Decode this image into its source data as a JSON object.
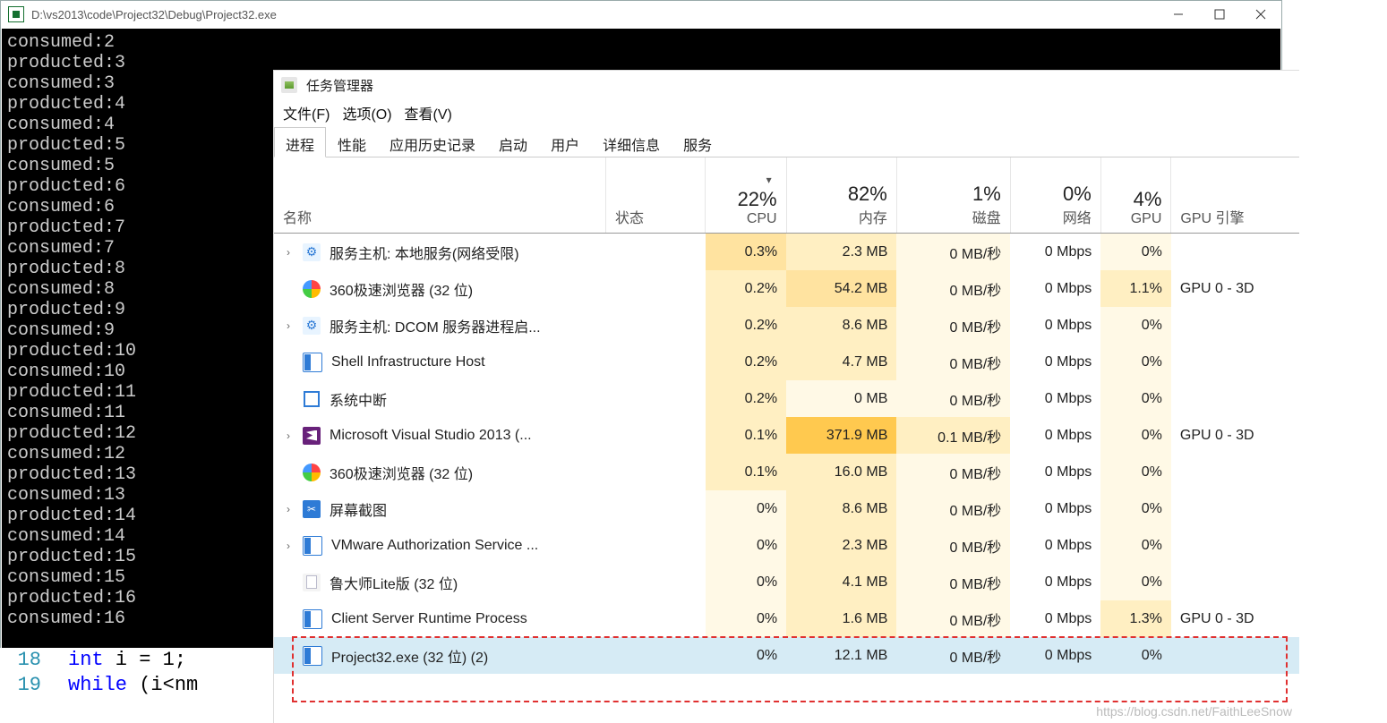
{
  "console": {
    "title": "D:\\vs2013\\code\\Project32\\Debug\\Project32.exe",
    "lines": [
      "consumed:2",
      "producted:3",
      "consumed:3",
      "producted:4",
      "consumed:4",
      "producted:5",
      "consumed:5",
      "producted:6",
      "consumed:6",
      "producted:7",
      "consumed:7",
      "producted:8",
      "consumed:8",
      "producted:9",
      "consumed:9",
      "producted:10",
      "consumed:10",
      "producted:11",
      "consumed:11",
      "producted:12",
      "consumed:12",
      "producted:13",
      "consumed:13",
      "producted:14",
      "consumed:14",
      "producted:15",
      "consumed:15",
      "producted:16",
      "consumed:16"
    ]
  },
  "code_fragment": {
    "line18": "int i = 1;",
    "line19_kw": "while",
    "line19_rest": " (i<nm"
  },
  "task_manager": {
    "title": "任务管理器",
    "menu": {
      "file": "文件(F)",
      "options": "选项(O)",
      "view": "查看(V)"
    },
    "tabs": [
      "进程",
      "性能",
      "应用历史记录",
      "启动",
      "用户",
      "详细信息",
      "服务"
    ],
    "active_tab": 0,
    "columns": {
      "name": "名称",
      "status": "状态",
      "cpu_pct": "22%",
      "cpu_lbl": "CPU",
      "mem_pct": "82%",
      "mem_lbl": "内存",
      "disk_pct": "1%",
      "disk_lbl": "磁盘",
      "net_pct": "0%",
      "net_lbl": "网络",
      "gpu_pct": "4%",
      "gpu_lbl": "GPU",
      "gpu_engine": "GPU 引擎"
    },
    "rows": [
      {
        "exp": true,
        "icon": "gear",
        "name": "服务主机: 本地服务(网络受限)",
        "cpu": "0.3%",
        "mem": "2.3 MB",
        "disk": "0 MB/秒",
        "net": "0 Mbps",
        "gpu": "0%",
        "eng": ""
      },
      {
        "exp": false,
        "icon": "chrome",
        "name": "360极速浏览器 (32 位)",
        "cpu": "0.2%",
        "mem": "54.2 MB",
        "disk": "0 MB/秒",
        "net": "0 Mbps",
        "gpu": "1.1%",
        "eng": "GPU 0 - 3D"
      },
      {
        "exp": true,
        "icon": "gear",
        "name": "服务主机: DCOM 服务器进程启...",
        "cpu": "0.2%",
        "mem": "8.6 MB",
        "disk": "0 MB/秒",
        "net": "0 Mbps",
        "gpu": "0%",
        "eng": ""
      },
      {
        "exp": false,
        "icon": "shell",
        "name": "Shell Infrastructure Host",
        "cpu": "0.2%",
        "mem": "4.7 MB",
        "disk": "0 MB/秒",
        "net": "0 Mbps",
        "gpu": "0%",
        "eng": ""
      },
      {
        "exp": false,
        "icon": "sys",
        "name": "系统中断",
        "cpu": "0.2%",
        "mem": "0 MB",
        "disk": "0 MB/秒",
        "net": "0 Mbps",
        "gpu": "0%",
        "eng": ""
      },
      {
        "exp": true,
        "icon": "vs",
        "name": "Microsoft Visual Studio 2013 (...",
        "cpu": "0.1%",
        "mem": "371.9 MB",
        "disk": "0.1 MB/秒",
        "net": "0 Mbps",
        "gpu": "0%",
        "eng": "GPU 0 - 3D"
      },
      {
        "exp": false,
        "icon": "chrome",
        "name": "360极速浏览器 (32 位)",
        "cpu": "0.1%",
        "mem": "16.0 MB",
        "disk": "0 MB/秒",
        "net": "0 Mbps",
        "gpu": "0%",
        "eng": ""
      },
      {
        "exp": true,
        "icon": "snip",
        "name": "屏幕截图",
        "cpu": "0%",
        "mem": "8.6 MB",
        "disk": "0 MB/秒",
        "net": "0 Mbps",
        "gpu": "0%",
        "eng": ""
      },
      {
        "exp": true,
        "icon": "shell",
        "name": "VMware Authorization Service ...",
        "cpu": "0%",
        "mem": "2.3 MB",
        "disk": "0 MB/秒",
        "net": "0 Mbps",
        "gpu": "0%",
        "eng": ""
      },
      {
        "exp": false,
        "icon": "generic",
        "name": "鲁大师Lite版 (32 位)",
        "cpu": "0%",
        "mem": "4.1 MB",
        "disk": "0 MB/秒",
        "net": "0 Mbps",
        "gpu": "0%",
        "eng": ""
      },
      {
        "exp": false,
        "icon": "shell",
        "name": "Client Server Runtime Process",
        "cpu": "0%",
        "mem": "1.6 MB",
        "disk": "0 MB/秒",
        "net": "0 Mbps",
        "gpu": "1.3%",
        "eng": "GPU 0 - 3D"
      },
      {
        "exp": false,
        "icon": "exe",
        "name": "Project32.exe (32 位) (2)",
        "cpu": "0%",
        "mem": "12.1 MB",
        "disk": "0 MB/秒",
        "net": "0 Mbps",
        "gpu": "0%",
        "eng": "",
        "selected": true
      }
    ]
  },
  "watermark": "https://blog.csdn.net/FaithLeeSnow"
}
